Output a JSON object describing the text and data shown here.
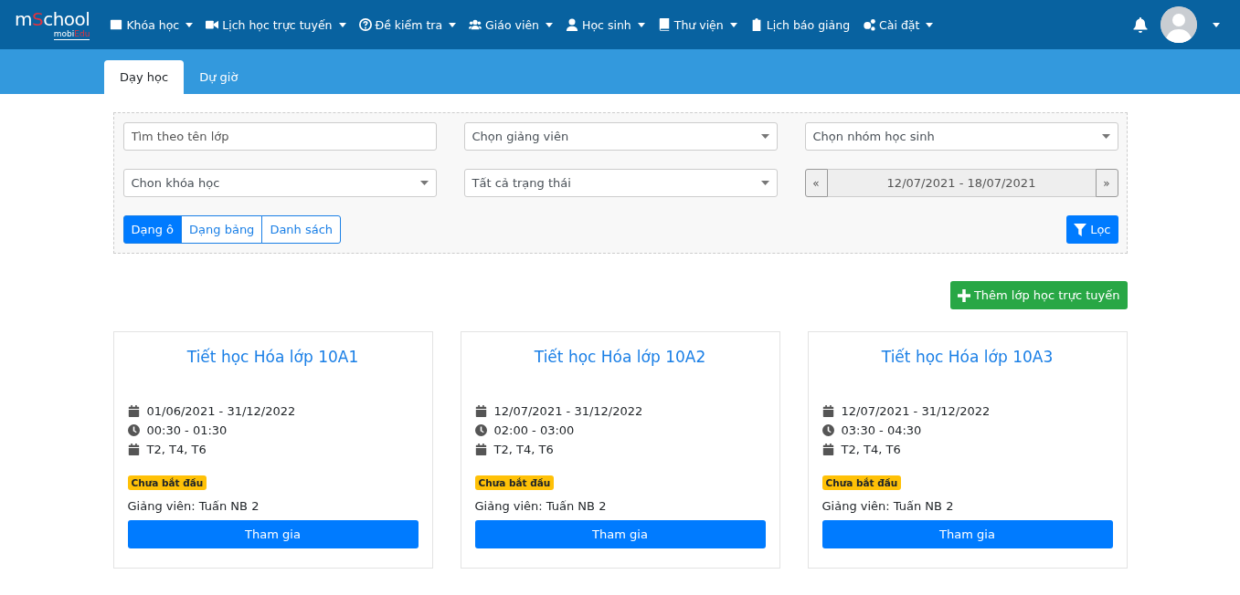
{
  "logo": {
    "title": [
      "m",
      "S",
      "chool"
    ],
    "subtitle": [
      "mobi",
      "Edu"
    ]
  },
  "nav": [
    {
      "label": "Khóa học",
      "dropdown": true
    },
    {
      "label": "Lịch học trực tuyến",
      "dropdown": true
    },
    {
      "label": "Đề kiểm tra",
      "dropdown": true
    },
    {
      "label": "Giáo viên",
      "dropdown": true
    },
    {
      "label": "Học sinh",
      "dropdown": true
    },
    {
      "label": "Thư viện",
      "dropdown": true
    },
    {
      "label": "Lịch báo giảng",
      "dropdown": false
    },
    {
      "label": "Cài đặt",
      "dropdown": true
    }
  ],
  "tabs": [
    {
      "label": "Dạy học",
      "selected": true
    },
    {
      "label": "Dự giờ",
      "selected": false
    }
  ],
  "filters": [
    {
      "kind": "input",
      "placeholder": "Tìm theo tên lớp"
    },
    {
      "kind": "select",
      "value": "Chọn giảng viên"
    },
    {
      "kind": "select",
      "value": "Chọn nhóm học sinh"
    },
    {
      "kind": "select",
      "value": "Chon khóa học"
    },
    {
      "kind": "select",
      "value": "Tất cả trạng thái"
    },
    {
      "kind": "range",
      "prev": "«",
      "value": "12/07/2021 - 18/07/2021",
      "next": "»"
    }
  ],
  "views": [
    {
      "label": "Dạng ô",
      "selected": true
    },
    {
      "label": "Dạng bảng",
      "selected": false
    },
    {
      "label": "Danh sách",
      "selected": false
    }
  ],
  "filter_button": "Lọc",
  "add_button": "Thêm lớp học trực tuyến",
  "classes": [
    {
      "title": "Tiết học Hóa lớp 10A1",
      "dates": "01/06/2021 - 31/12/2022",
      "time": "00:30 - 01:30",
      "days": "T2, T4, T6",
      "status": "Chưa bắt đầu",
      "teacher": "Giảng viên: Tuấn NB 2",
      "button": "Tham gia"
    },
    {
      "title": "Tiết học Hóa lớp 10A2",
      "dates": "12/07/2021 - 31/12/2022",
      "time": "02:00 - 03:00",
      "days": "T2, T4, T6",
      "status": "Chưa bắt đầu",
      "teacher": "Giảng viên: Tuấn NB 2",
      "button": "Tham gia"
    },
    {
      "title": "Tiết học Hóa lớp 10A3",
      "dates": "12/07/2021 - 31/12/2022",
      "time": "03:30 - 04:30",
      "days": "T2, T4, T6",
      "status": "Chưa bắt đầu",
      "teacher": "Giảng viên: Tuấn NB 2",
      "button": "Tham gia"
    }
  ]
}
